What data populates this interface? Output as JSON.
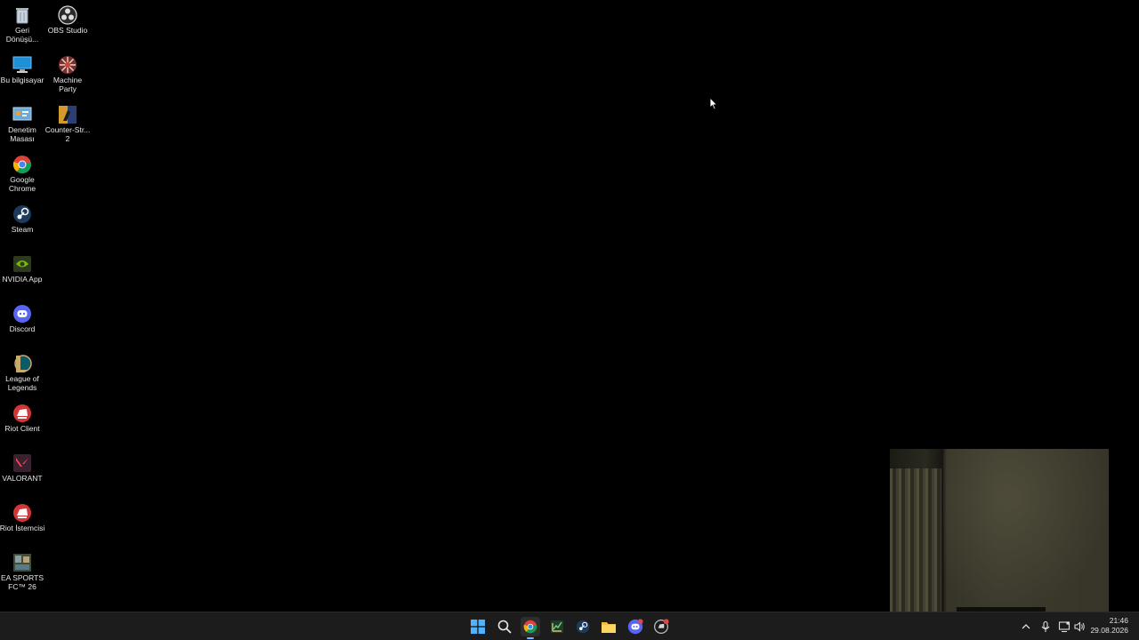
{
  "desktop": {
    "icons": [
      {
        "label": "Geri Dönüşü...",
        "icon": "recycle-bin-icon"
      },
      {
        "label": "OBS Studio",
        "icon": "obs-icon"
      },
      {
        "label": "Bu bilgisayar",
        "icon": "computer-icon"
      },
      {
        "label": "Machine Party",
        "icon": "machine-party-icon"
      },
      {
        "label": "Denetim Masası",
        "icon": "control-panel-icon"
      },
      {
        "label": "Counter-Str... 2",
        "icon": "counter-strike-icon"
      },
      {
        "label": "Google Chrome",
        "icon": "chrome-icon"
      },
      {
        "label": "Steam",
        "icon": "steam-icon"
      },
      {
        "label": "NVIDIA App",
        "icon": "nvidia-icon"
      },
      {
        "label": "Discord",
        "icon": "discord-icon"
      },
      {
        "label": "League of Legends",
        "icon": "league-icon"
      },
      {
        "label": "Riot Client",
        "icon": "riot-client-icon"
      },
      {
        "label": "VALORANT",
        "icon": "valorant-icon"
      },
      {
        "label": "Riot İstemcisi",
        "icon": "riot-istemcisi-icon"
      },
      {
        "label": "EA SPORTS FC™ 26",
        "icon": "ea-fc-icon"
      }
    ]
  },
  "taskbar": {
    "apps": [
      "start-icon",
      "search-icon",
      "chrome-icon",
      "stocks-icon",
      "steam-icon",
      "file-explorer-icon",
      "discord-icon",
      "riot-client-icon"
    ],
    "active_app": "chrome-icon",
    "tray": [
      "chevron-up-icon",
      "microphone-icon",
      "network-icon",
      "volume-icon"
    ],
    "clock": {
      "time": "21:46",
      "date": "29.08.2026"
    }
  },
  "colors": {
    "taskbar_bg": "#1c1c1c",
    "accent": "#7fb5ff",
    "desktop_bg": "#000000"
  }
}
